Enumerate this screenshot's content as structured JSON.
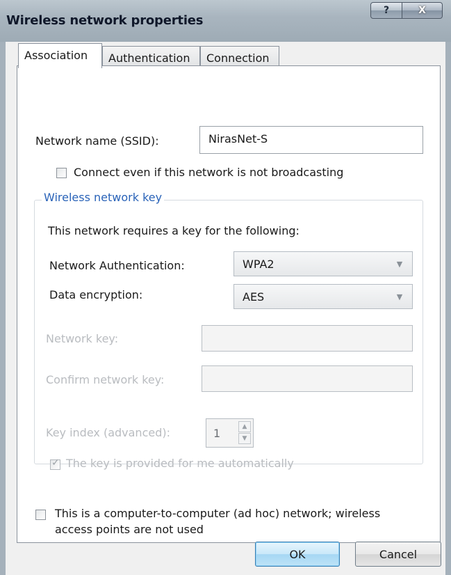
{
  "window": {
    "title": "Wireless network properties",
    "help_label": "?",
    "close_label": "X"
  },
  "tabs": [
    {
      "label": "Association",
      "active": true
    },
    {
      "label": "Authentication",
      "active": false
    },
    {
      "label": "Connection",
      "active": false
    }
  ],
  "association": {
    "ssid_label": "Network name (SSID):",
    "ssid_value": "NirasNet-S",
    "broadcast_label": "Connect even if this network is not broadcasting",
    "broadcast_checked": false,
    "group_title": "Wireless network key",
    "key_intro": "This network requires a key for the following:",
    "auth_label": "Network Authentication:",
    "auth_value": "WPA2",
    "encryption_label": "Data encryption:",
    "encryption_value": "AES",
    "network_key_label": "Network key:",
    "network_key_value": "",
    "confirm_key_label": "Confirm network key:",
    "confirm_key_value": "",
    "key_index_label": "Key index (advanced):",
    "key_index_value": "1",
    "auto_key_label": "The key is provided for me automatically",
    "auto_key_checked": true,
    "adhoc_label_line1": "This is a computer-to-computer (ad hoc) network; wireless",
    "adhoc_label_line2": "access points are not used",
    "adhoc_checked": false
  },
  "buttons": {
    "ok": "OK",
    "cancel": "Cancel"
  },
  "colors": {
    "group_title": "#2a63b8",
    "disabled_text": "#b9bcc0",
    "default_button": "#bde3f7"
  }
}
